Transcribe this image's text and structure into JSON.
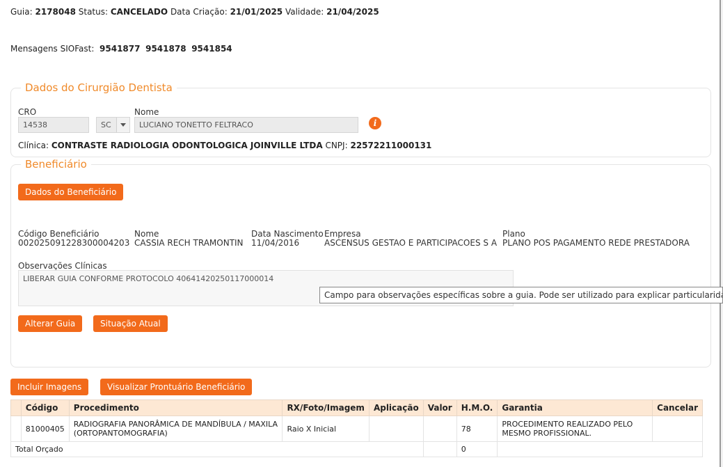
{
  "header": {
    "guia_label": "Guia:",
    "guia_value": "2178048",
    "status_label": "Status:",
    "status_value": "CANCELADO",
    "criacao_label": "Data Criação:",
    "criacao_value": "21/01/2025",
    "validade_label": "Validade:",
    "validade_value": "21/04/2025",
    "mensagens_label": "Mensagens SIOFast:",
    "mensagens": [
      "9541877",
      "9541878",
      "9541854"
    ]
  },
  "dentista": {
    "legend": "Dados do Cirurgião Dentista",
    "cro_label": "CRO",
    "cro_value": "14538",
    "uf_value": "SC",
    "nome_label": "Nome",
    "nome_value": "LUCIANO TONETTO FELTRACO",
    "info_icon": "i",
    "clinica_label": "Clínica:",
    "clinica_value": "CONTRASTE RADIOLOGIA ODONTOLOGICA JOINVILLE LTDA",
    "cnpj_label": "CNPJ:",
    "cnpj_value": "22572211000131"
  },
  "beneficiario": {
    "legend": "Beneficiário",
    "dados_button": "Dados do Beneficiário",
    "codigo_label": "Código Beneficiário",
    "codigo_value": "00202509122830000420​3",
    "nome_label": "Nome",
    "nome_value": "CASSIA RECH TRAMONTIN",
    "nascimento_label": "Data Nascimento",
    "nascimento_value": "11/04/2016",
    "empresa_label": "Empresa",
    "empresa_value": "ASCENSUS GESTAO E PARTICIPACOES S A",
    "plano_label": "Plano",
    "plano_value": "PLANO POS PAGAMENTO REDE PRESTADORA",
    "obs_label": "Observações Clínicas",
    "obs_value": "LIBERAR GUIA CONFORME PROTOCOLO 40641420250117000014",
    "tooltip": "Campo para observações específicas sobre a guia. Pode ser utilizado para explicar particularidades do tratam",
    "alterar_button": "Alterar Guia",
    "situacao_button": "Situação Atual"
  },
  "actions": {
    "incluir_button": "Incluir Imagens",
    "prontuario_button": "Visualizar Prontuário Beneficiário"
  },
  "table": {
    "headers": [
      "Código",
      "Procedimento",
      "RX/Foto/Imagem",
      "Aplicação",
      "Valor",
      "H.M.O.",
      "Garantia",
      "Cancelar"
    ],
    "row": {
      "codigo": "81000405",
      "procedimento": "RADIOGRAFIA PANORÂMICA DE MANDÍBULA / MAXILA (ORTOPANTOMOGRAFIA)",
      "rx": "Raio X Inicial",
      "aplicacao": "",
      "valor": "",
      "hmo": "78",
      "garantia": "PROCEDIMENTO REALIZADO PELO MESMO PROFISSIONAL.",
      "cancelar": ""
    },
    "total_label": "Total Orçado",
    "total_hmo": "0"
  }
}
